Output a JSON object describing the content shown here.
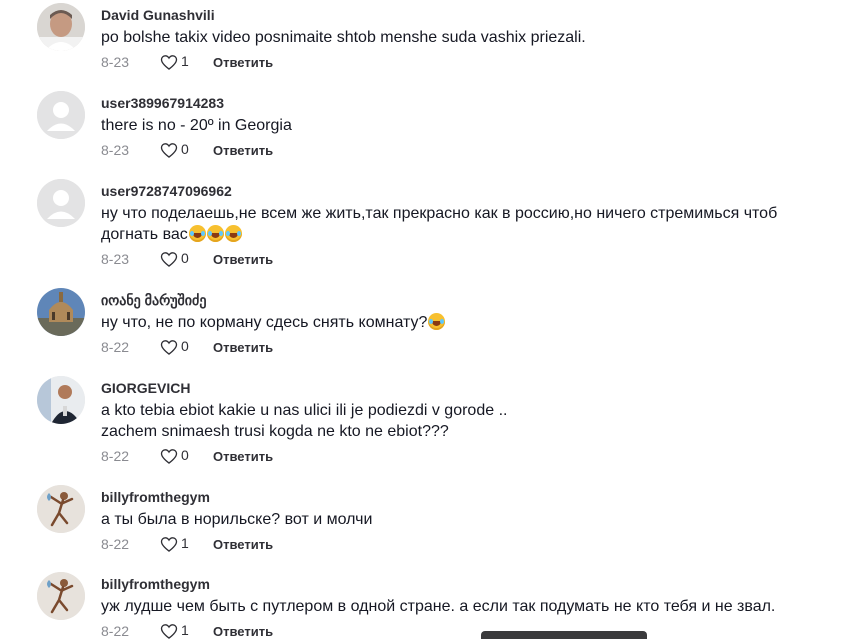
{
  "reply_label": "Ответить",
  "comments": [
    {
      "username": "David Gunashvili",
      "lines": [
        "po bolshe takix video posnimaite shtob menshe suda vashix priezali."
      ],
      "date": "8-23",
      "likes": "1",
      "reply": "Ответить",
      "avatar": "photo-man-portrait"
    },
    {
      "username": "user389967914283",
      "lines": [
        "there is no - 20º in Georgia"
      ],
      "date": "8-23",
      "likes": "0",
      "reply": "Ответить",
      "avatar": "default-avatar"
    },
    {
      "username": "user9728747096962",
      "lines": [
        "ну что поделаешь,не всем же жить,так прекрасно как в россию,но ничего стремимься чтоб",
        "догнать вас"
      ],
      "emoji_count": 3,
      "emoji": "grinning-sweat-emoji",
      "date": "8-23",
      "likes": "0",
      "reply": "Ответить",
      "avatar": "default-avatar"
    },
    {
      "username": "იოანე მარუშიძე",
      "lines": [
        "ну что, не по корману сдесь снять комнату?"
      ],
      "emoji_count": 1,
      "emoji": "tears-of-joy-emoji",
      "date": "8-22",
      "likes": "0",
      "reply": "Ответить",
      "avatar": "photo-cathedral"
    },
    {
      "username": "GIORGEVICH",
      "lines": [
        "a kto tebia ebiot kakie u nas ulici ili je podiezdi v gorode ..",
        "zachem snimaesh trusi kogda ne kto ne ebiot???"
      ],
      "date": "8-22",
      "likes": "0",
      "reply": "Ответить",
      "avatar": "photo-man-dark-suit"
    },
    {
      "username": "billyfromthegym",
      "lines": [
        "а ты была в норильске? вот и молчи"
      ],
      "date": "8-22",
      "likes": "1",
      "reply": "Ответить",
      "avatar": "photo-figure-sketch"
    },
    {
      "username": "billyfromthegym",
      "lines": [
        "уж лудше чем быть с путлером в одной стране. а если так подумать не кто тебя и не звал."
      ],
      "date": "8-22",
      "likes": "1",
      "reply": "Ответить",
      "avatar": "photo-figure-sketch"
    }
  ]
}
